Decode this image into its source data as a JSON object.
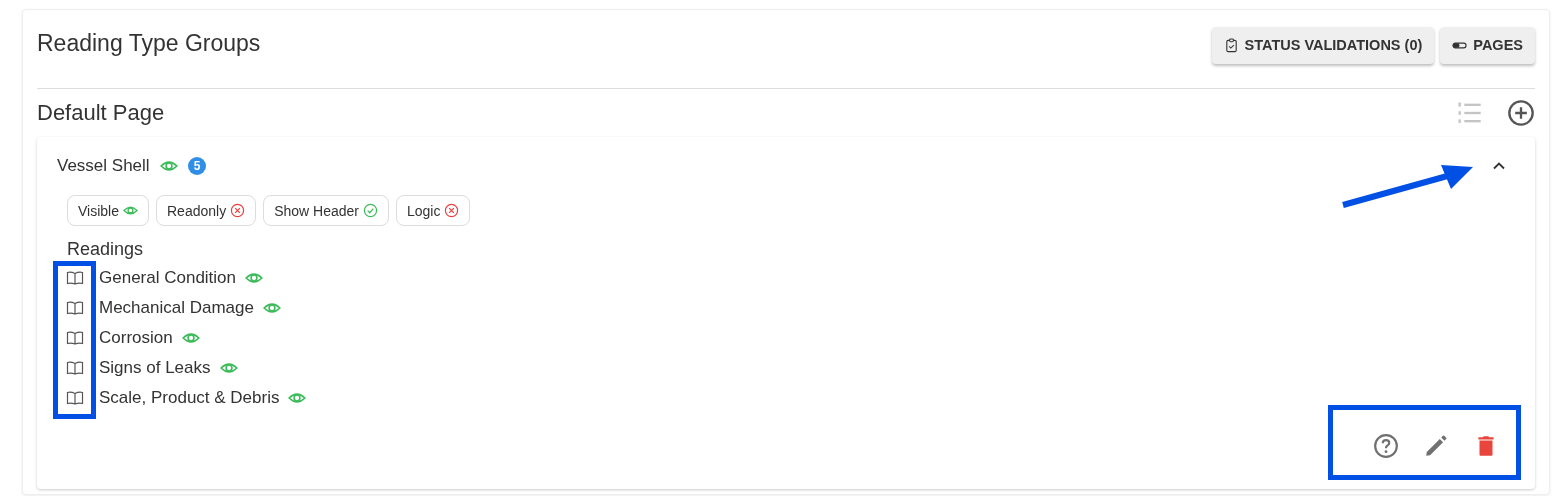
{
  "header": {
    "title": "Reading Type Groups",
    "buttons": [
      {
        "kind": "clipboard",
        "label": "STATUS VALIDATIONS (0)"
      },
      {
        "kind": "toggle",
        "label": "PAGES"
      }
    ]
  },
  "page": {
    "title": "Default Page",
    "group": {
      "title": "Vessel Shell",
      "visible": true,
      "count": "5",
      "expanded": true,
      "flags": [
        {
          "label": "Visible",
          "kind": "eye",
          "on": true
        },
        {
          "label": "Readonly",
          "kind": "check",
          "on": false
        },
        {
          "label": "Show Header",
          "kind": "check",
          "on": true
        },
        {
          "label": "Logic",
          "kind": "check",
          "on": false
        }
      ],
      "readings_title": "Readings",
      "readings": [
        {
          "label": "General Condition",
          "visible": true
        },
        {
          "label": "Mechanical Damage",
          "visible": true
        },
        {
          "label": "Corrosion",
          "visible": true
        },
        {
          "label": "Signs of Leaks",
          "visible": true
        },
        {
          "label": "Scale, Product & Debris",
          "visible": true
        }
      ]
    }
  },
  "annotations": [
    {
      "kind": "arrow"
    },
    {
      "kind": "icon-box"
    },
    {
      "kind": "action-box"
    }
  ]
}
